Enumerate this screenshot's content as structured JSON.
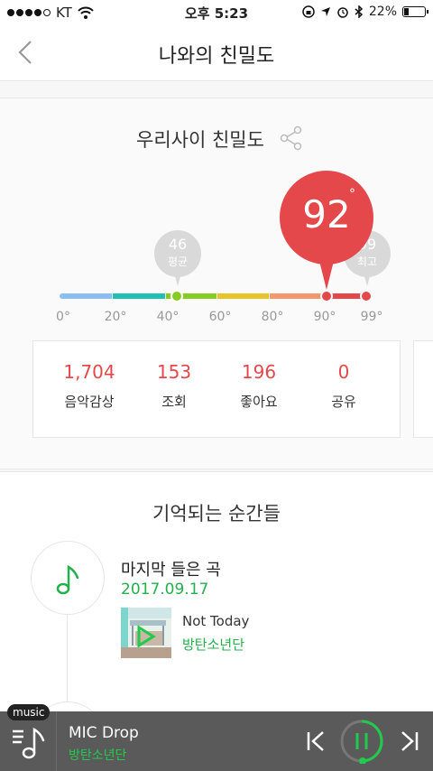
{
  "status_bar": {
    "carrier": "KT",
    "time": "오후 5:23",
    "battery_percent": "22%",
    "battery_level": 0.22,
    "signal_dots": 4
  },
  "header": {
    "title": "나와의 친밀도",
    "back_icon": "chevron-left-icon"
  },
  "intimacy": {
    "title": "우리사이 친밀도",
    "share_icon": "share-icon",
    "current_value": "92",
    "degree_symbol": "°",
    "average": {
      "value": "46",
      "label": "평균"
    },
    "max": {
      "value": "99",
      "label": "최고"
    },
    "scale_ticks": [
      "0°",
      "20°",
      "40°",
      "60°",
      "80°",
      "90°",
      "99°"
    ],
    "segment_colors": [
      "#8bbef5",
      "#1fc1b3",
      "#86cc24",
      "#e7c42a",
      "#f5986c",
      "#e5484a"
    ],
    "stats": [
      {
        "value": "1,704",
        "label": "음악감상"
      },
      {
        "value": "153",
        "label": "조회"
      },
      {
        "value": "196",
        "label": "좋아요"
      },
      {
        "value": "0",
        "label": "공유"
      }
    ]
  },
  "moments": {
    "title": "기억되는 순간들",
    "items": [
      {
        "title": "마지막 들은 곡",
        "date": "2017.09.17",
        "song": "Not Today",
        "artist": "방탄소년단",
        "icon": "music-note-icon"
      }
    ]
  },
  "player": {
    "badge": "music",
    "title": "MIC Drop",
    "artist": "방탄소년단",
    "accent_color": "#22c94c"
  }
}
